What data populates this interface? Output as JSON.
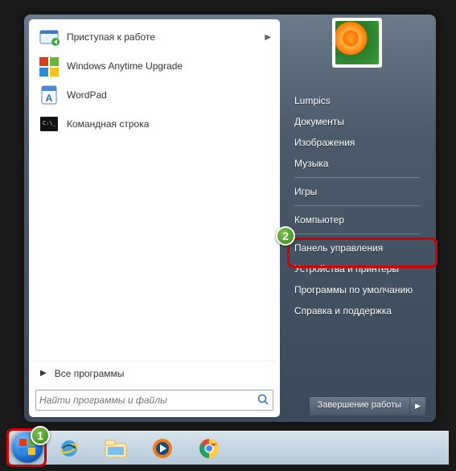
{
  "programs": [
    {
      "label": "Приступая к работе",
      "icon": "getting-started",
      "hasSubmenu": true
    },
    {
      "label": "Windows Anytime Upgrade",
      "icon": "anytime-upgrade",
      "hasSubmenu": false
    },
    {
      "label": "WordPad",
      "icon": "wordpad",
      "hasSubmenu": false
    },
    {
      "label": "Командная строка",
      "icon": "cmd",
      "hasSubmenu": false
    }
  ],
  "all_programs": "Все программы",
  "search_placeholder": "Найти программы и файлы",
  "right_groups": [
    [
      "Lumpics",
      "Документы",
      "Изображения",
      "Музыка"
    ],
    [
      "Игры"
    ],
    [
      "Компьютер"
    ],
    [
      "Панель управления",
      "Устройства и принтеры",
      "Программы по умолчанию",
      "Справка и поддержка"
    ]
  ],
  "shutdown_label": "Завершение работы",
  "annotations": {
    "1": "1",
    "2": "2"
  }
}
